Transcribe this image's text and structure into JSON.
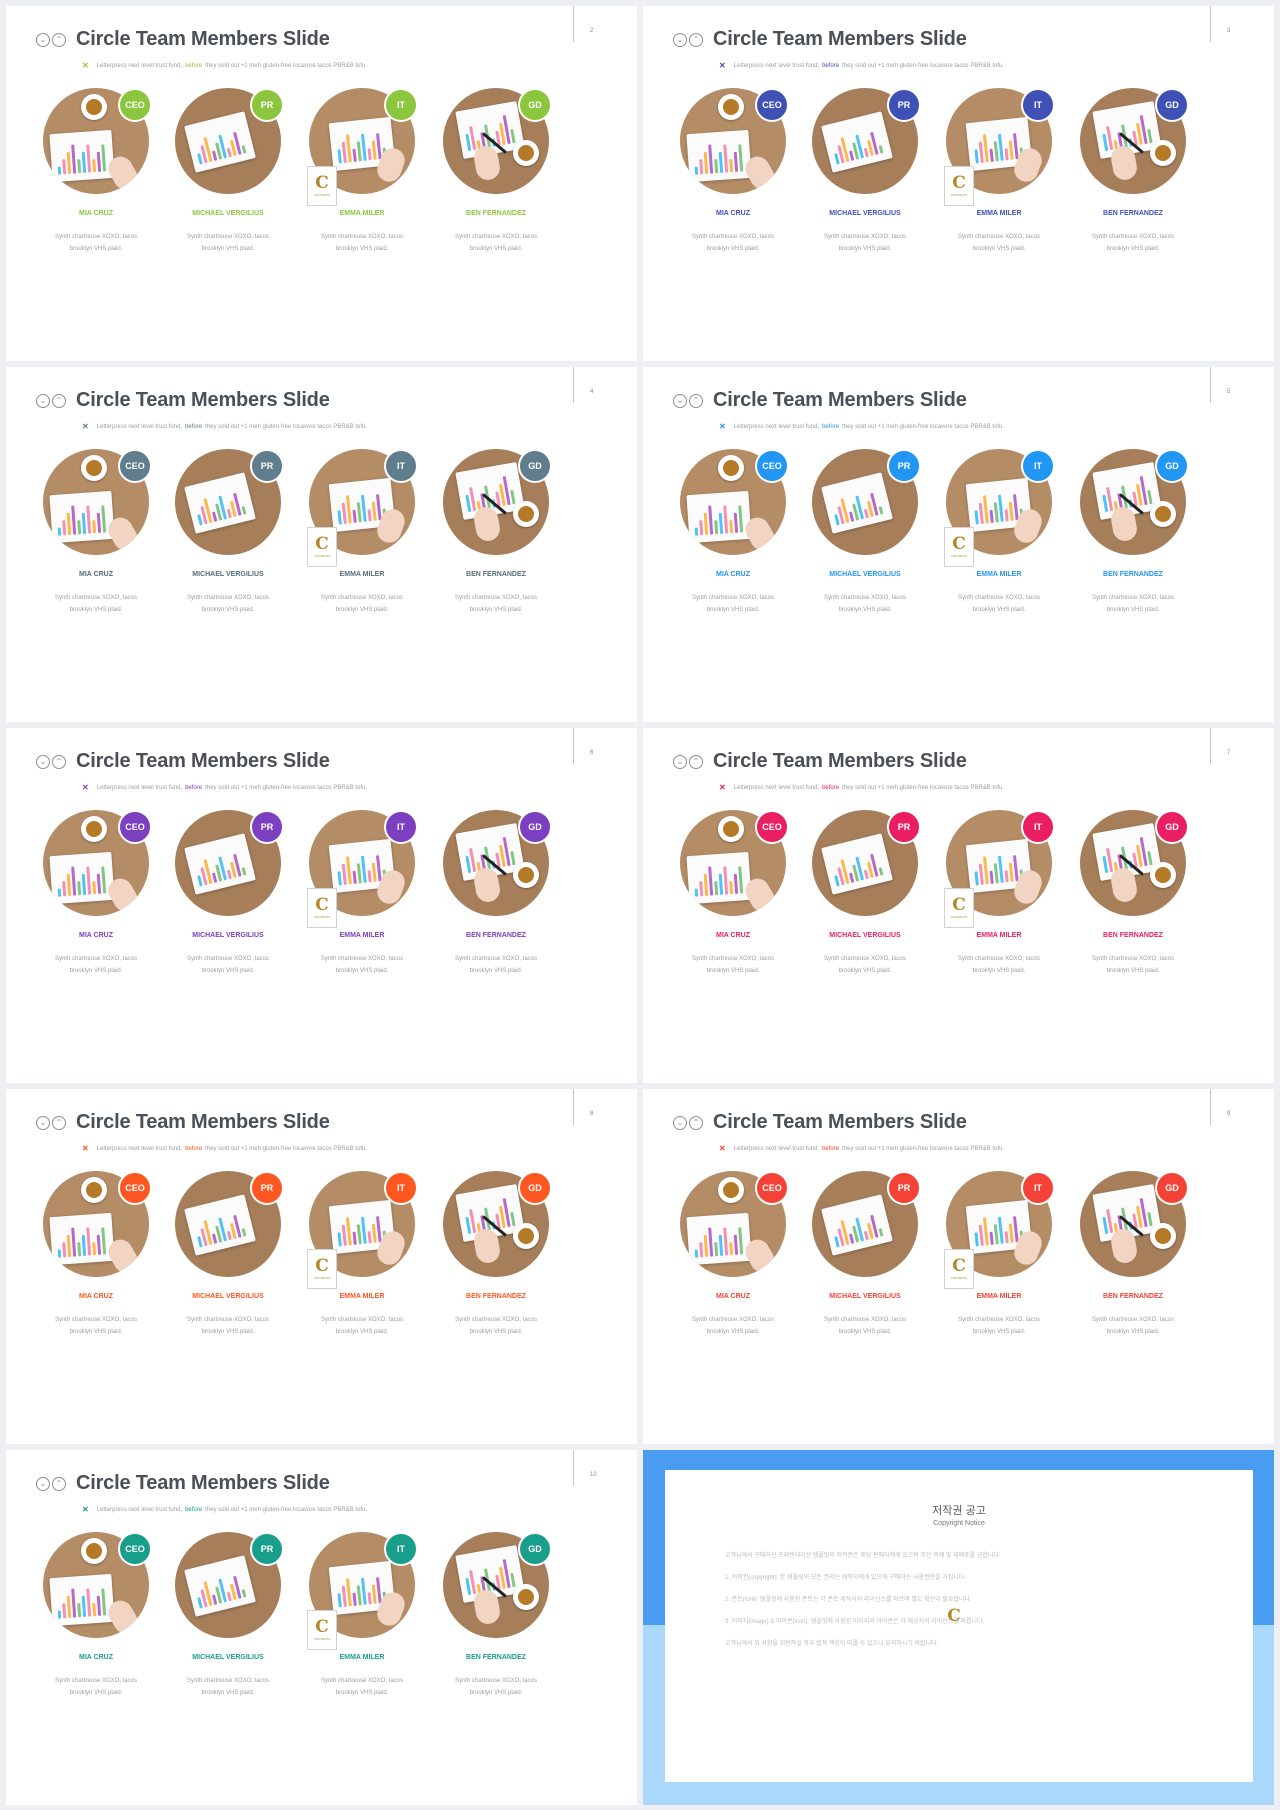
{
  "slides": [
    {
      "title": "Circle Team Members Slide",
      "subtitle_pre": "Letterpress next level trust fund,",
      "subtitle_em": "before",
      "subtitle_post": "they sold out +1 meh gluten-free locavore tacos PBR&B tofu.",
      "page": "2",
      "accent": "#8cc63f",
      "name_color": "#8cc63f"
    },
    {
      "title": "Circle Team Members Slide",
      "subtitle_pre": "Letterpress next level trust fund,",
      "subtitle_em": "before",
      "subtitle_post": "they sold out +1 meh gluten-free locavore tacos PBR&B tofu.",
      "page": "3",
      "accent": "#3f51b5",
      "name_color": "#3f51b5"
    },
    {
      "title": "Circle Team Members Slide",
      "subtitle_pre": "Letterpress next level trust fund,",
      "subtitle_em": "before",
      "subtitle_post": "they sold out +1 meh gluten-free locavore tacos PBR&B tofu.",
      "page": "4",
      "accent": "#607d8b",
      "name_color": "#546e7a"
    },
    {
      "title": "Circle Team Members Slide",
      "subtitle_pre": "Letterpress next level trust fund,",
      "subtitle_em": "before",
      "subtitle_post": "they sold out +1 meh gluten-free locavore tacos PBR&B tofu.",
      "page": "5",
      "accent": "#2196f3",
      "name_color": "#2196f3"
    },
    {
      "title": "Circle Team Members Slide",
      "subtitle_pre": "Letterpress next level trust fund,",
      "subtitle_em": "before",
      "subtitle_post": "they sold out +1 meh gluten-free locavore tacos PBR&B tofu.",
      "page": "6",
      "accent": "#7b3fbf",
      "name_color": "#7b3fbf"
    },
    {
      "title": "Circle Team Members Slide",
      "subtitle_pre": "Letterpress next level trust fund,",
      "subtitle_em": "before",
      "subtitle_post": "they sold out +1 meh gluten-free locavore tacos PBR&B tofu.",
      "page": "7",
      "accent": "#e91e63",
      "name_color": "#e91e63"
    },
    {
      "title": "Circle Team Members Slide",
      "subtitle_pre": "Letterpress next level trust fund,",
      "subtitle_em": "before",
      "subtitle_post": "they sold out +1 meh gluten-free locavore tacos PBR&B tofu.",
      "page": "8",
      "accent": "#ff5722",
      "name_color": "#ff5722"
    },
    {
      "title": "Circle Team Members Slide",
      "subtitle_pre": "Letterpress next level trust fund,",
      "subtitle_em": "before",
      "subtitle_post": "they sold out +1 meh gluten-free locavore tacos PBR&B tofu.",
      "page": "9",
      "accent": "#f44336",
      "name_color": "#f44336"
    },
    {
      "title": "Circle Team Members Slide",
      "subtitle_pre": "Letterpress next level trust fund,",
      "subtitle_em": "before",
      "subtitle_post": "they sold out +1 meh gluten-free locavore tacos PBR&B tofu.",
      "page": "10",
      "accent": "#1a9e8c",
      "name_color": "#1a9e8c"
    }
  ],
  "members": [
    {
      "role": "CEO",
      "name": "MIA CRUZ",
      "desc1": "Synth chartreuse XOXO, tacos",
      "desc2": "brooklyn VHS plaid."
    },
    {
      "role": "PR",
      "name": "MICHAEL VERGILIUS",
      "desc1": "Synth chartreuse XOXO, tacos",
      "desc2": "brooklyn VHS plaid."
    },
    {
      "role": "IT",
      "name": "EMMA MILER",
      "desc1": "Synth chartreuse XOXO, tacos",
      "desc2": "brooklyn VHS plaid."
    },
    {
      "role": "GD",
      "name": "BEN FERNANDEZ",
      "desc1": "Synth chartreuse XOXO, tacos",
      "desc2": "brooklyn VHS plaid."
    }
  ],
  "logo": {
    "letter": "C",
    "text": "CONTENTS"
  },
  "copyright": {
    "title": "저작권 공고",
    "subtitle": "Copyright Notice",
    "paragraphs": [
      "고객님께서 구매하신 프레젠테이션 템플릿의 저작권은 해당 판매자에게 있으며 무단 복제 및 재배포를 금합니다.",
      "1. 저작권(copyright): 본 템플릿의 모든 권리는 제작자에게 있으며 구매자는 사용권만을 가집니다.",
      "2. 폰트(font): 템플릿에 사용된 폰트는 각 폰트 제작사의 라이선스를 따르며 별도 확인이 필요합니다.",
      "3. 이미지(image) & 아이콘(icon): 템플릿에 사용된 이미지와 아이콘은 각 제공처의 라이선스를 따릅니다.",
      "고객님께서 위 사항을 위반하실 경우 법적 책임이 따를 수 있으니 유의하시기 바랍니다."
    ]
  }
}
